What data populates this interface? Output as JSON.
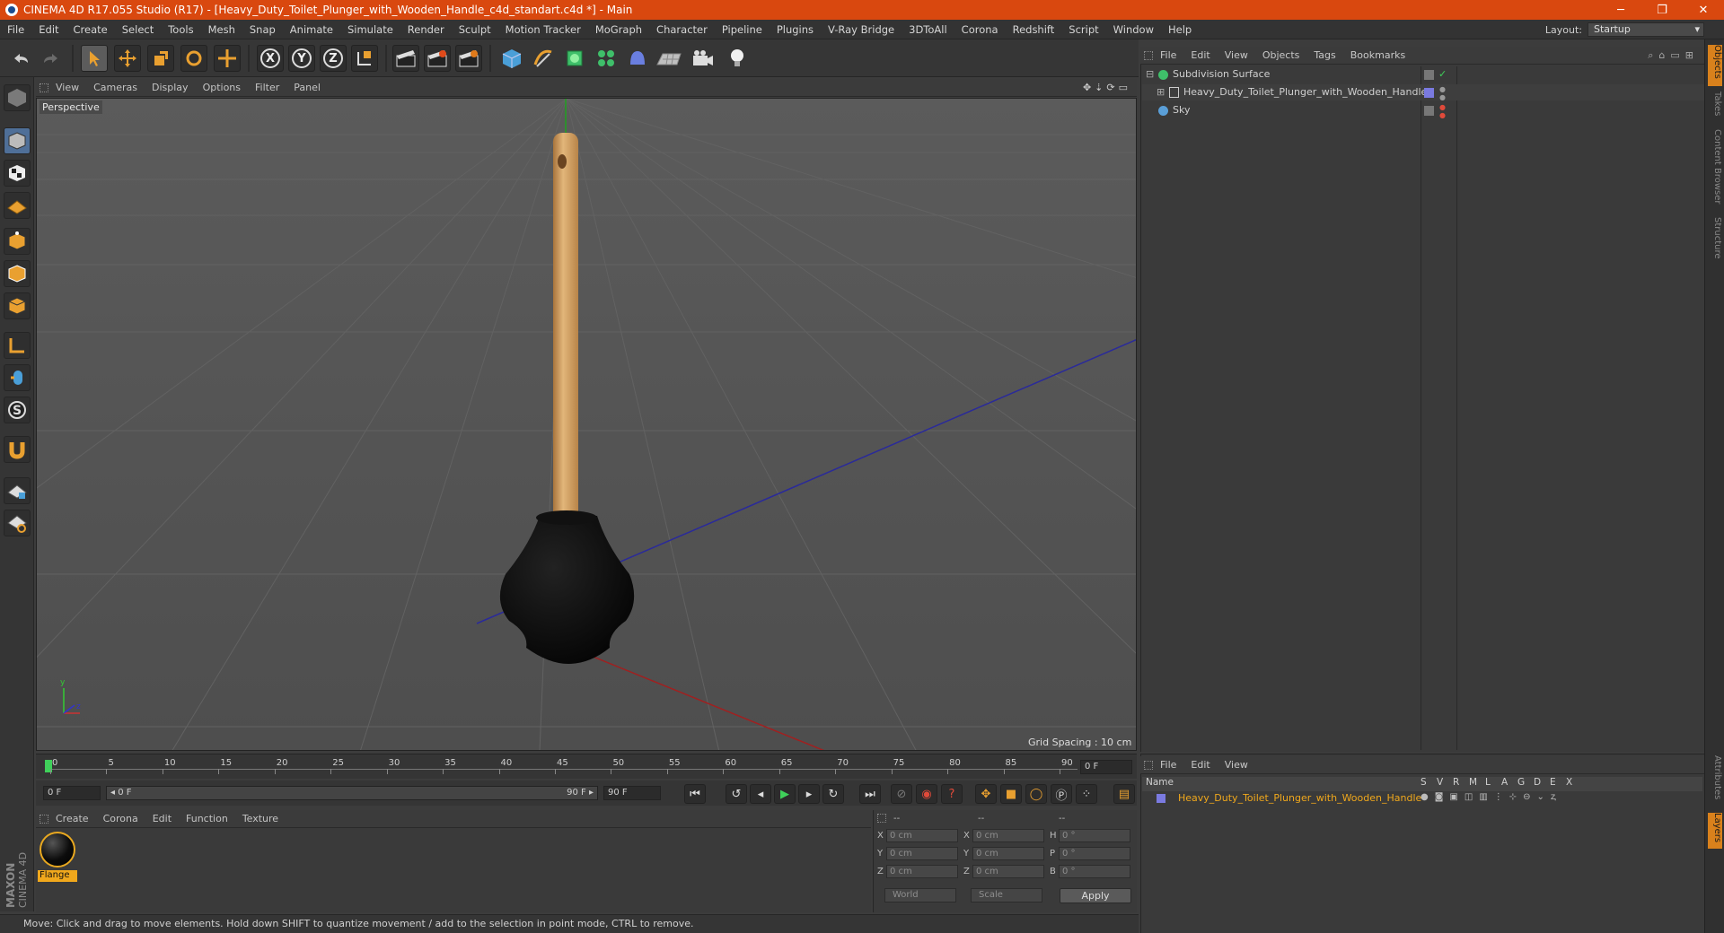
{
  "window": {
    "title": "CINEMA 4D R17.055 Studio (R17) - [Heavy_Duty_Toilet_Plunger_with_Wooden_Handle_c4d_standart.c4d *] - Main",
    "minimize": "─",
    "maximize": "❐",
    "close": "✕"
  },
  "menubar": {
    "items": [
      "File",
      "Edit",
      "Create",
      "Select",
      "Tools",
      "Mesh",
      "Snap",
      "Animate",
      "Simulate",
      "Render",
      "Sculpt",
      "Motion Tracker",
      "MoGraph",
      "Character",
      "Pipeline",
      "Plugins",
      "V-Ray Bridge",
      "3DToAll",
      "Corona",
      "Redshift",
      "Script",
      "Window",
      "Help"
    ],
    "layout_label": "Layout:",
    "layout_value": "Startup"
  },
  "toolbar": {
    "axis_x": "X",
    "axis_y": "Y",
    "axis_z": "Z"
  },
  "viewport": {
    "menu": [
      "View",
      "Cameras",
      "Display",
      "Options",
      "Filter",
      "Panel"
    ],
    "label": "Perspective",
    "grid_spacing": "Grid Spacing : 10 cm"
  },
  "timeline": {
    "ticks": [
      "0",
      "5",
      "10",
      "15",
      "20",
      "25",
      "30",
      "35",
      "40",
      "45",
      "50",
      "55",
      "60",
      "65",
      "70",
      "75",
      "80",
      "85",
      "90"
    ],
    "current_frame": "0 F",
    "start_field": "0 F",
    "range_start": "◂ 0 F",
    "range_end": "90 F ▸",
    "end_field": "90 F"
  },
  "material_manager": {
    "menu": [
      "Create",
      "Corona",
      "Edit",
      "Function",
      "Texture"
    ],
    "material_name": "Flange"
  },
  "coordinates": {
    "headers": [
      "--",
      "--",
      "--"
    ],
    "rows": [
      {
        "a": "X",
        "av": "0 cm",
        "b": "X",
        "bv": "0 cm",
        "c": "H",
        "cv": "0 °"
      },
      {
        "a": "Y",
        "av": "0 cm",
        "b": "Y",
        "bv": "0 cm",
        "c": "P",
        "cv": "0 °"
      },
      {
        "a": "Z",
        "av": "0 cm",
        "b": "Z",
        "bv": "0 cm",
        "c": "B",
        "cv": "0 °"
      }
    ],
    "mode_world": "World",
    "mode_scale": "Scale",
    "apply": "Apply"
  },
  "status_bar": {
    "text": "Move: Click and drag to move elements. Hold down SHIFT to quantize movement / add to the selection in point mode, CTRL to remove."
  },
  "object_manager": {
    "menu": [
      "File",
      "Edit",
      "View",
      "Objects",
      "Tags",
      "Bookmarks"
    ],
    "objects": [
      {
        "name": "Subdivision Surface",
        "indent": 0
      },
      {
        "name": "Heavy_Duty_Toilet_Plunger_with_Wooden_Handle",
        "indent": 1
      },
      {
        "name": "Sky",
        "indent": 0
      }
    ]
  },
  "layer_manager": {
    "menu": [
      "File",
      "Edit",
      "View"
    ],
    "columns": {
      "name": "Name",
      "flags": [
        "S",
        "V",
        "R",
        "M",
        "L",
        "A",
        "G",
        "D",
        "E",
        "X"
      ]
    },
    "layers": [
      {
        "name": "Heavy_Duty_Toilet_Plunger_with_Wooden_Handle"
      }
    ]
  },
  "right_tabs": [
    "Objects",
    "Takes",
    "Content Browser",
    "Structure",
    "Attributes",
    "Layers"
  ],
  "brand": {
    "maxon": "MAXON",
    "cinema": "CINEMA 4D"
  },
  "colors": {
    "accent": "#d9480f",
    "selection": "#f0a81c",
    "handle": "#d4a36a"
  }
}
